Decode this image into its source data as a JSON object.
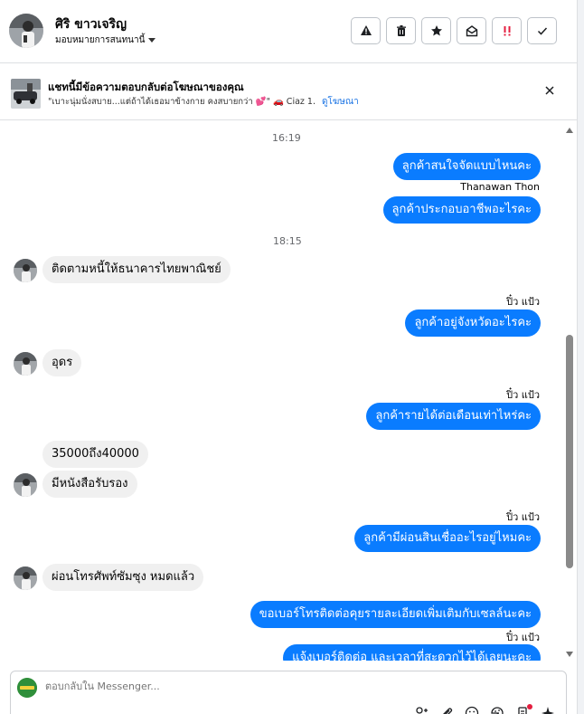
{
  "header": {
    "name": "ศิริ ขาวเจริญ",
    "assign_label": "มอบหมายการสนทนานี้"
  },
  "ad_banner": {
    "title": "แชทนี้มีข้อความตอบกลับต่อโฆษณาของคุณ",
    "quote": "\"เบาะนุ่มนั่งสบาย...แต่ถ้าได้เธอมาข้างกาย คงสบายกว่า 💕\" 🚗 Ciaz 1.2 ...",
    "link": "ดูโฆษณา"
  },
  "thread": {
    "ts1": "16:19",
    "ts2": "18:15",
    "sender_agent": "Thanawan Thon",
    "sender_pew": "ปิ๋ว แป้ว",
    "msgs": {
      "m1": "ลูกค้าสนใจจัดแบบไหนคะ",
      "m2": "ลูกค้าประกอบอาชีพอะไรคะ",
      "m3": "ติดตามหนี้ให้ธนาคารไทยพาณิชย์",
      "m4": "ลูกค้าอยู่จังหวัดอะไรคะ",
      "m5": "อุดร",
      "m6": "ลูกค้ารายได้ต่อเดือนเท่าไหร่คะ",
      "m7": "35000ถึง40000",
      "m8": "มีหนังสือรับรอง",
      "m9": "ลูกค้ามีผ่อนสินเชื่ออะไรอยู่ไหมคะ",
      "m10": "ผ่อนโทรศัพท์ซัมซุง หมดแล้ว",
      "m11": "ขอเบอร์โทรติดต่อคุยรายละเอียดเพิ่มเติมกับเซลล์นะคะ",
      "m12": "แจ้งเบอร์ติดต่อ และเวลาที่สะดวกไว้ได้เลยนะคะ"
    }
  },
  "composer": {
    "placeholder": "ตอบกลับใน Messenger..."
  },
  "colors": {
    "outgoing_bubble": "#0a7cff",
    "incoming_bubble": "#f0f0f0",
    "link": "#1b74e4"
  }
}
